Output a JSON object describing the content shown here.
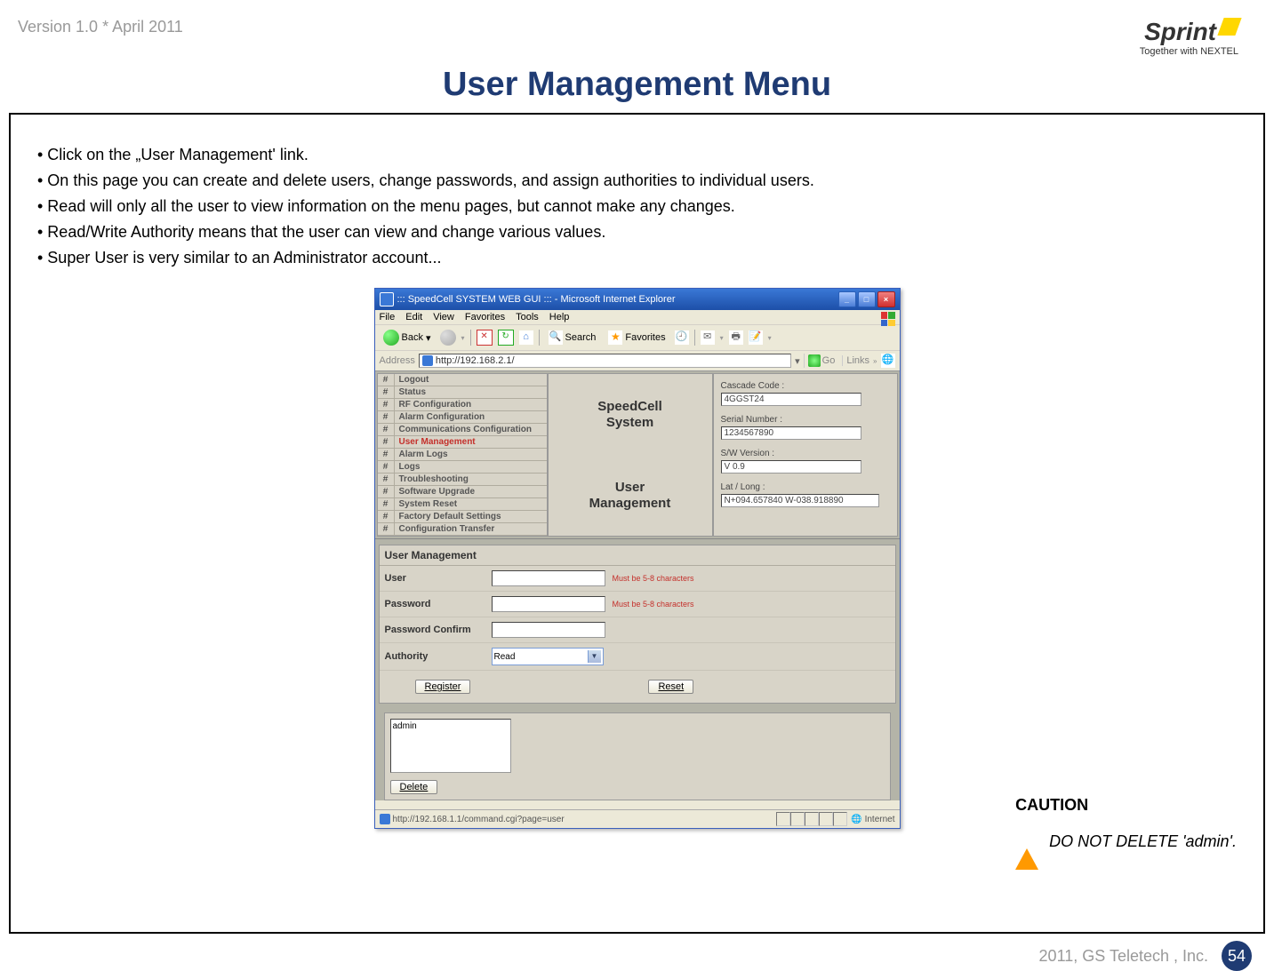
{
  "meta": {
    "version": "Version 1.0 * April 2011",
    "brand": "Sprint",
    "brand_sub": "Together with NEXTEL",
    "footer": "2011, GS Teletech , Inc.",
    "page_num": "54"
  },
  "slide": {
    "title": "User Management Menu",
    "bullets": [
      "• Click on the „User Management' link.",
      "• On this page you can create and delete users, change passwords, and assign authorities to individual users.",
      "• Read will only all the user to view information on the menu pages, but cannot make any changes.",
      "• Read/Write Authority means that the user can view and change various values.",
      "• Super User is very similar to an Administrator account..."
    ],
    "caution_title": "CAUTION",
    "caution_text": "DO NOT DELETE 'admin'."
  },
  "browser": {
    "title": "::: SpeedCell SYSTEM WEB GUI ::: - Microsoft Internet Explorer",
    "menus": [
      "File",
      "Edit",
      "View",
      "Favorites",
      "Tools",
      "Help"
    ],
    "toolbar": {
      "back": "Back",
      "search": "Search",
      "favorites": "Favorites"
    },
    "address_label": "Address",
    "address_url": "http://192.168.2.1/",
    "go": "Go",
    "links": "Links",
    "status_left": "http://192.168.1.1/command.cgi?page=user",
    "status_right": "Internet"
  },
  "nav": {
    "items": [
      "Logout",
      "Status",
      "RF Configuration",
      "Alarm Configuration",
      "Communications Configuration",
      "User Management",
      "Alarm Logs",
      "Logs",
      "Troubleshooting",
      "Software Upgrade",
      "System Reset",
      "Factory Default Settings",
      "Configuration Transfer"
    ],
    "active_index": 5
  },
  "center": {
    "system_name": "SpeedCell System",
    "page_name": "User Management"
  },
  "info": {
    "cascade_label": "Cascade Code :",
    "cascade_value": "4GGST24",
    "serial_label": "Serial Number :",
    "serial_value": "1234567890",
    "sw_label": "S/W Version :",
    "sw_value": "V 0.9",
    "latlong_label": "Lat / Long :",
    "latlong_value": "N+094.657840 W-038.918890"
  },
  "form": {
    "section_title": "User Management",
    "user_label": "User",
    "password_label": "Password",
    "confirm_label": "Password Confirm",
    "authority_label": "Authority",
    "authority_value": "Read",
    "hint": "Must be 5-8 characters",
    "register": "Register",
    "reset": "Reset",
    "userlist": [
      "admin"
    ],
    "delete": "Delete"
  }
}
